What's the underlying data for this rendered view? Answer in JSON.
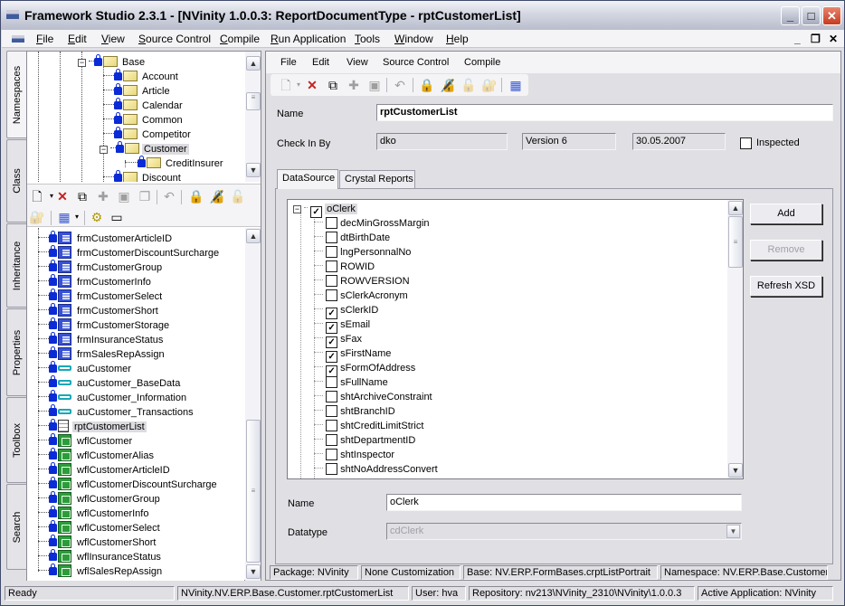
{
  "window": {
    "title": "Framework Studio 2.3.1 - [NVinity 1.0.0.3: ReportDocumentType - rptCustomerList]",
    "controls": {
      "minimize": "_",
      "maximize": "□",
      "close": "✕"
    },
    "mdi_controls": {
      "minimize": "_",
      "restore": "❐",
      "close": "✕"
    }
  },
  "menubar": {
    "items": [
      {
        "label": "File",
        "u": "F",
        "rest": "ile"
      },
      {
        "label": "Edit",
        "u": "E",
        "rest": "dit"
      },
      {
        "label": "View",
        "u": "V",
        "rest": "iew"
      },
      {
        "label": "Source Control",
        "u": "S",
        "rest": "ource Control"
      },
      {
        "label": "Compile",
        "u": "C",
        "rest": "ompile"
      },
      {
        "label": "Run Application",
        "u": "R",
        "rest": "un Application"
      },
      {
        "label": "Tools",
        "u": "T",
        "rest": "ools"
      },
      {
        "label": "Window",
        "u": "W",
        "rest": "indow"
      },
      {
        "label": "Help",
        "u": "H",
        "rest": "elp"
      }
    ]
  },
  "sidetabs": [
    "Namespaces",
    "Class",
    "Inheritance",
    "Properties",
    "Toolbox",
    "Search"
  ],
  "namespace_tree": {
    "nodes": [
      {
        "label": "Base",
        "expanded": true
      },
      {
        "label": "Account"
      },
      {
        "label": "Article"
      },
      {
        "label": "Calendar"
      },
      {
        "label": "Common"
      },
      {
        "label": "Competitor"
      },
      {
        "label": "Customer",
        "expanded": true,
        "selected": true
      },
      {
        "label": "CreditInsurer"
      },
      {
        "label": "Discount"
      }
    ]
  },
  "class_toolbar": {
    "icons": [
      "new-icon",
      "delete-icon",
      "copy-icon",
      "puzzle-icon",
      "save-icon",
      "save-all-icon",
      "undo-icon",
      "checkout-icon",
      "checkin-icon",
      "undo-checkout-icon",
      "source-status-icon",
      "grid-icon",
      "compile-icon",
      "open-icon"
    ]
  },
  "class_list": {
    "items": [
      {
        "label": "frmCustomerArticleID",
        "type": "form"
      },
      {
        "label": "frmCustomerDiscountSurcharge",
        "type": "form"
      },
      {
        "label": "frmCustomerGroup",
        "type": "form"
      },
      {
        "label": "frmCustomerInfo",
        "type": "form"
      },
      {
        "label": "frmCustomerSelect",
        "type": "form"
      },
      {
        "label": "frmCustomerShort",
        "type": "form"
      },
      {
        "label": "frmCustomerStorage",
        "type": "form"
      },
      {
        "label": "frmInsuranceStatus",
        "type": "form"
      },
      {
        "label": "frmSalesRepAssign",
        "type": "form"
      },
      {
        "label": "auCustomer",
        "type": "key"
      },
      {
        "label": "auCustomer_BaseData",
        "type": "key"
      },
      {
        "label": "auCustomer_Information",
        "type": "key"
      },
      {
        "label": "auCustomer_Transactions",
        "type": "key"
      },
      {
        "label": "rptCustomerList",
        "type": "report",
        "selected": true
      },
      {
        "label": "wflCustomer",
        "type": "workflow"
      },
      {
        "label": "wflCustomerAlias",
        "type": "workflow"
      },
      {
        "label": "wflCustomerArticleID",
        "type": "workflow"
      },
      {
        "label": "wflCustomerDiscountSurcharge",
        "type": "workflow"
      },
      {
        "label": "wflCustomerGroup",
        "type": "workflow"
      },
      {
        "label": "wflCustomerInfo",
        "type": "workflow"
      },
      {
        "label": "wflCustomerSelect",
        "type": "workflow"
      },
      {
        "label": "wflCustomerShort",
        "type": "workflow"
      },
      {
        "label": "wflInsuranceStatus",
        "type": "workflow"
      },
      {
        "label": "wflSalesRepAssign",
        "type": "workflow"
      }
    ]
  },
  "editor": {
    "menu": [
      "File",
      "Edit",
      "View",
      "Source Control",
      "Compile"
    ],
    "name_label": "Name",
    "name_value": "rptCustomerList",
    "checkin_label": "Check In By",
    "checkin_user": "dko",
    "version": "Version 6",
    "date": "30.05.2007",
    "inspected_label": "Inspected",
    "inspected": false,
    "tabs": [
      "DataSource",
      "Crystal Reports"
    ],
    "active_tab": "DataSource",
    "datasource": {
      "root": {
        "label": "oClerk",
        "checked": true
      },
      "fields": [
        {
          "label": "decMinGrossMargin",
          "checked": false
        },
        {
          "label": "dtBirthDate",
          "checked": false
        },
        {
          "label": "lngPersonnalNo",
          "checked": false
        },
        {
          "label": "ROWID",
          "checked": false
        },
        {
          "label": "ROWVERSION",
          "checked": false
        },
        {
          "label": "sClerkAcronym",
          "checked": false
        },
        {
          "label": "sClerkID",
          "checked": true
        },
        {
          "label": "sEmail",
          "checked": true
        },
        {
          "label": "sFax",
          "checked": true
        },
        {
          "label": "sFirstName",
          "checked": true
        },
        {
          "label": "sFormOfAddress",
          "checked": true
        },
        {
          "label": "sFullName",
          "checked": false
        },
        {
          "label": "shtArchiveConstraint",
          "checked": false
        },
        {
          "label": "shtBranchID",
          "checked": false
        },
        {
          "label": "shtCreditLimitStrict",
          "checked": false
        },
        {
          "label": "shtDepartmentID",
          "checked": false
        },
        {
          "label": "shtInspector",
          "checked": false
        },
        {
          "label": "shtNoAddressConvert",
          "checked": false
        }
      ],
      "buttons": {
        "add": "Add",
        "remove": "Remove",
        "refresh": "Refresh XSD"
      },
      "name_label": "Name",
      "name_value": "oClerk",
      "datatype_label": "Datatype",
      "datatype_value": "cdClerk"
    },
    "status": {
      "package": "Package: NVinity",
      "customization": "None Customization",
      "base": "Base: NV.ERP.FormBases.crptListPortrait",
      "namespace": "Namespace: NV.ERP.Base.Customer"
    }
  },
  "statusbar": {
    "state": "Ready",
    "path": "NVinity.NV.ERP.Base.Customer.rptCustomerList",
    "user": "User: hva",
    "repository": "Repository: nv213\\NVinity_2310\\NVinity\\1.0.0.3",
    "app": "Active Application: NVinity"
  }
}
